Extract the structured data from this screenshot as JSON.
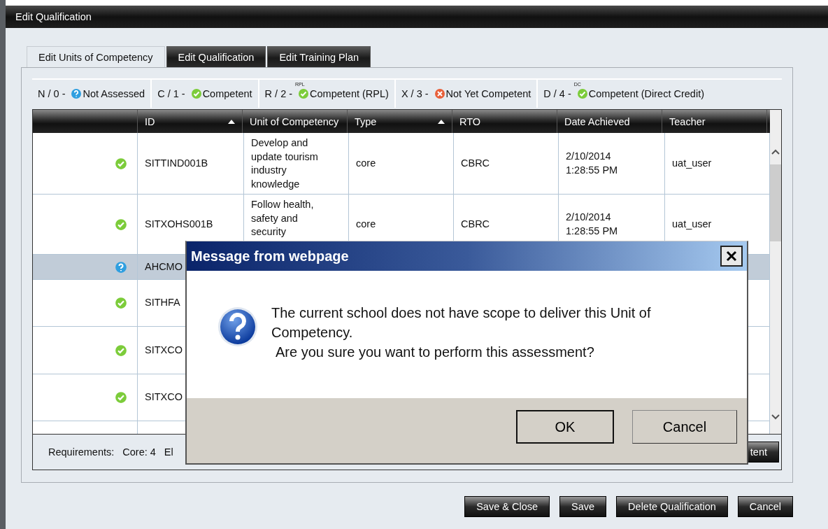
{
  "window": {
    "title": "Edit Qualification"
  },
  "tabs": [
    {
      "label": "Edit Units of Competency",
      "selected": true
    },
    {
      "label": "Edit Qualification",
      "selected": false
    },
    {
      "label": "Edit Training Plan",
      "selected": false
    }
  ],
  "legend": [
    {
      "code": "N / 0 -",
      "kind": "not_assessed",
      "label": "Not Assessed"
    },
    {
      "code": "C / 1 -",
      "kind": "competent",
      "label": "Competent"
    },
    {
      "code": "R / 2 -",
      "kind": "competent",
      "badge": "RPL",
      "label": "Competent (RPL)"
    },
    {
      "code": "X / 3 -",
      "kind": "not_yet",
      "label": "Not Yet Competent"
    },
    {
      "code": "D / 4 -",
      "kind": "competent",
      "badge": "DC",
      "label": "Competent (Direct Credit)"
    }
  ],
  "grid": {
    "columns": [
      {
        "label": "ID",
        "sorted": true
      },
      {
        "label": "Unit of Competency",
        "sorted": false
      },
      {
        "label": "Type",
        "sorted": true
      },
      {
        "label": "RTO",
        "sorted": false
      },
      {
        "label": "Date Achieved",
        "sorted": false
      },
      {
        "label": "Teacher",
        "sorted": false
      }
    ],
    "rows": [
      {
        "kind": "competent",
        "selected": false,
        "id": "SITTIND001B",
        "unit": "Develop and update tourism industry knowledge",
        "type": "core",
        "rto": "CBRC",
        "date": "2/10/2014 1:28:55 PM",
        "teacher": "uat_user"
      },
      {
        "kind": "competent",
        "selected": false,
        "id": "SITXOHS001B",
        "unit": "Follow health, safety and security",
        "type": "core",
        "rto": "CBRC",
        "date": "2/10/2014 1:28:55 PM",
        "teacher": "uat_user"
      },
      {
        "kind": "not_assessed",
        "selected": true,
        "id": "AHCMO"
      },
      {
        "kind": "competent",
        "selected": false,
        "id": "SITHFA"
      },
      {
        "kind": "competent",
        "selected": false,
        "id": "SITXCO"
      },
      {
        "kind": "competent",
        "selected": false,
        "id": "SITXCO"
      }
    ]
  },
  "footer": {
    "label": "Requirements:",
    "core": "Core: 4",
    "elective": "El",
    "button": "tent"
  },
  "dialog": {
    "title": "Message from webpage",
    "message": "The current school does not have scope to deliver this Unit of Competency.",
    "question": "Are you sure you want to perform this assessment?",
    "buttons": [
      {
        "label": "OK",
        "default": true
      },
      {
        "label": "Cancel",
        "default": false
      }
    ]
  },
  "buttons": [
    "Save & Close",
    "Save",
    "Delete Qualification",
    "Cancel"
  ]
}
